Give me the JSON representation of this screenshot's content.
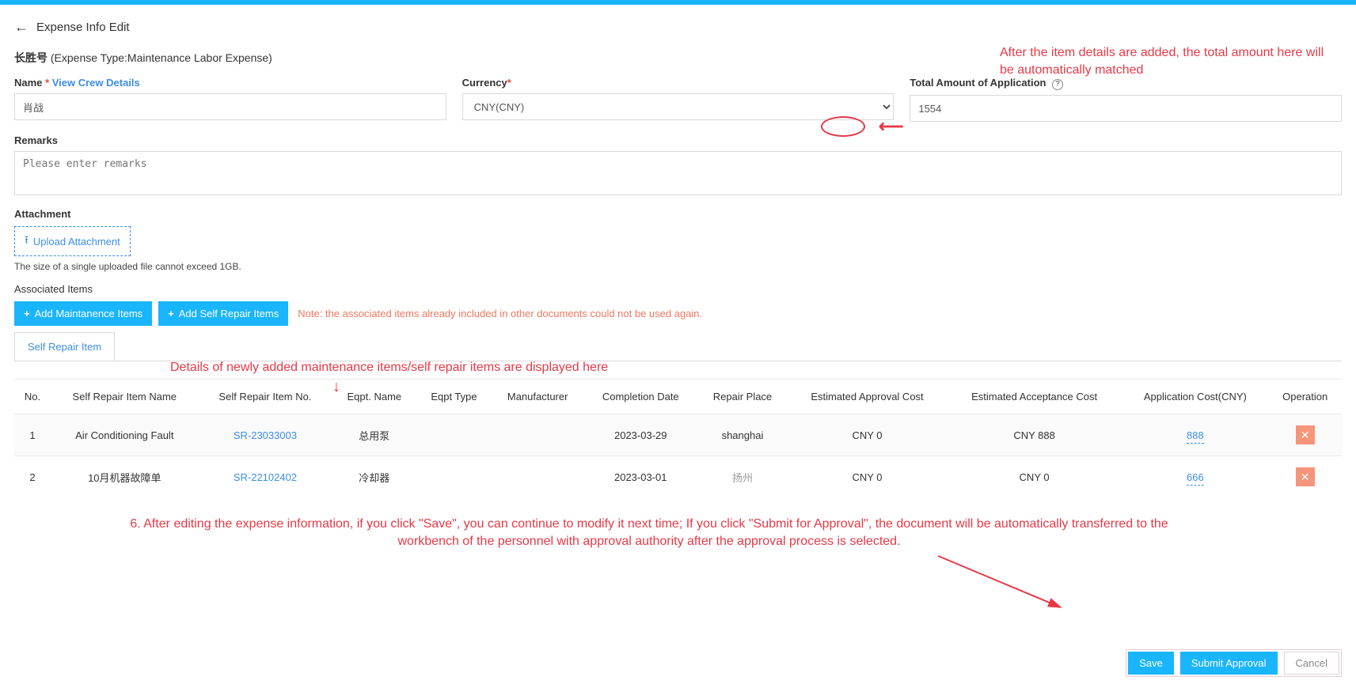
{
  "header": {
    "title": "Expense Info Edit"
  },
  "subheader": {
    "entity": "长胜号",
    "type_label": "(Expense Type:Maintenance Labor Expense)"
  },
  "form": {
    "name_label": "Name",
    "view_crew": "View Crew Details",
    "name_value": "肖战",
    "currency_label": "Currency",
    "currency_value": "CNY(CNY)",
    "total_label": "Total Amount of Application",
    "total_value": "1554",
    "remarks_label": "Remarks",
    "remarks_placeholder": "Please enter remarks"
  },
  "attachment": {
    "label": "Attachment",
    "upload": "Upload Attachment",
    "hint": "The size of a single uploaded file cannot exceed 1GB."
  },
  "associated": {
    "label": "Associated Items",
    "add_maint": "Add  Maintanence  Items",
    "add_self": "Add  Self  Repair  Items",
    "note": "Note: the associated items already included in other documents could not be used again."
  },
  "tabs": {
    "self_repair": "Self Repair Item"
  },
  "table": {
    "headers": {
      "no": "No.",
      "item_name": "Self Repair Item Name",
      "item_no": "Self Repair Item No.",
      "eqpt_name": "Eqpt. Name",
      "eqpt_type": "Eqpt Type",
      "manufacturer": "Manufacturer",
      "completion": "Completion Date",
      "repair_place": "Repair Place",
      "est_approval": "Estimated Approval Cost",
      "est_acceptance": "Estimated Acceptance Cost",
      "app_cost": "Application Cost(CNY)",
      "operation": "Operation"
    },
    "rows": [
      {
        "no": "1",
        "name": "Air Conditioning Fault",
        "item_no": "SR-23033003",
        "eqpt_name": "总用泵",
        "eqpt_type": "",
        "manufacturer": "",
        "completion": "2023-03-29",
        "place": "shanghai",
        "approval": "CNY 0",
        "acceptance": "CNY 888",
        "app_cost": "888"
      },
      {
        "no": "2",
        "name": "10月机器故障单",
        "item_no": "SR-22102402",
        "eqpt_name": "冷却器",
        "eqpt_type": "",
        "manufacturer": "",
        "completion": "2023-03-01",
        "place": "扬州",
        "approval": "CNY 0",
        "acceptance": "CNY 0",
        "app_cost": "666"
      }
    ]
  },
  "footer": {
    "save": "Save",
    "submit": "Submit Approval",
    "cancel": "Cancel"
  },
  "annotations": {
    "total_note": "After the item details are added, the total amount here will be automatically matched",
    "items_note": "Details of newly added maintenance items/self repair items are displayed here",
    "step6": "6. After editing the expense information, if you click \"Save\", you can continue to modify it next time; If you click \"Submit for Approval\", the document will be automatically transferred to the workbench of the personnel with approval authority after the approval process is selected."
  }
}
